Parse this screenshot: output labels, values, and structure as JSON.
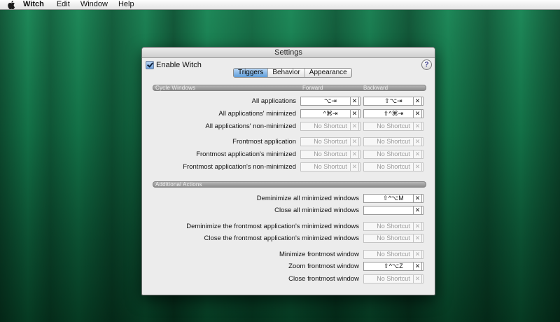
{
  "menubar": {
    "app_name": "Witch",
    "items": [
      "Edit",
      "Window",
      "Help"
    ]
  },
  "window": {
    "title": "Settings",
    "enable_label": "Enable Witch",
    "enable_checked": true,
    "help_label": "?",
    "tabs": [
      {
        "label": "Triggers",
        "active": true
      },
      {
        "label": "Behavior",
        "active": false
      },
      {
        "label": "Appearance",
        "active": false
      }
    ]
  },
  "cycle_windows": {
    "section_label": "Cycle Windows",
    "col_forward": "Forward",
    "col_backward": "Backward",
    "rows": [
      {
        "label": "All applications",
        "forward": "⌥⇥",
        "backward": "⇧⌥⇥"
      },
      {
        "label": "All applications' minimized",
        "forward": "^⌘⇥",
        "backward": "⇧^⌘⇥"
      },
      {
        "label": "All applications' non-minimized",
        "forward": "No Shortcut",
        "backward": "No Shortcut"
      },
      {
        "label": "Frontmost application",
        "forward": "No Shortcut",
        "backward": "No Shortcut"
      },
      {
        "label": "Frontmost application's minimized",
        "forward": "No Shortcut",
        "backward": "No Shortcut"
      },
      {
        "label": "Frontmost application's non-minimized",
        "forward": "No Shortcut",
        "backward": "No Shortcut"
      }
    ]
  },
  "additional_actions": {
    "section_label": "Additional Actions",
    "rows": [
      {
        "label": "Deminimize all minimized windows",
        "shortcut": "⇧^⌥M"
      },
      {
        "label": "Close all minimized windows",
        "shortcut": ""
      },
      {
        "label": "Deminimize the frontmost application's minimized windows",
        "shortcut": "No Shortcut"
      },
      {
        "label": "Close the frontmost application's minimized windows",
        "shortcut": "No Shortcut"
      },
      {
        "label": "Minimize frontmost window",
        "shortcut": "No Shortcut"
      },
      {
        "label": "Zoom frontmost window",
        "shortcut": "⇧^⌥Z"
      },
      {
        "label": "Close frontmost window",
        "shortcut": "No Shortcut"
      }
    ]
  },
  "clear_glyph": "✕",
  "colors": {
    "desktop_green": "#137147",
    "tab_active": "#5f9fdc",
    "window_bg": "#ececec"
  }
}
